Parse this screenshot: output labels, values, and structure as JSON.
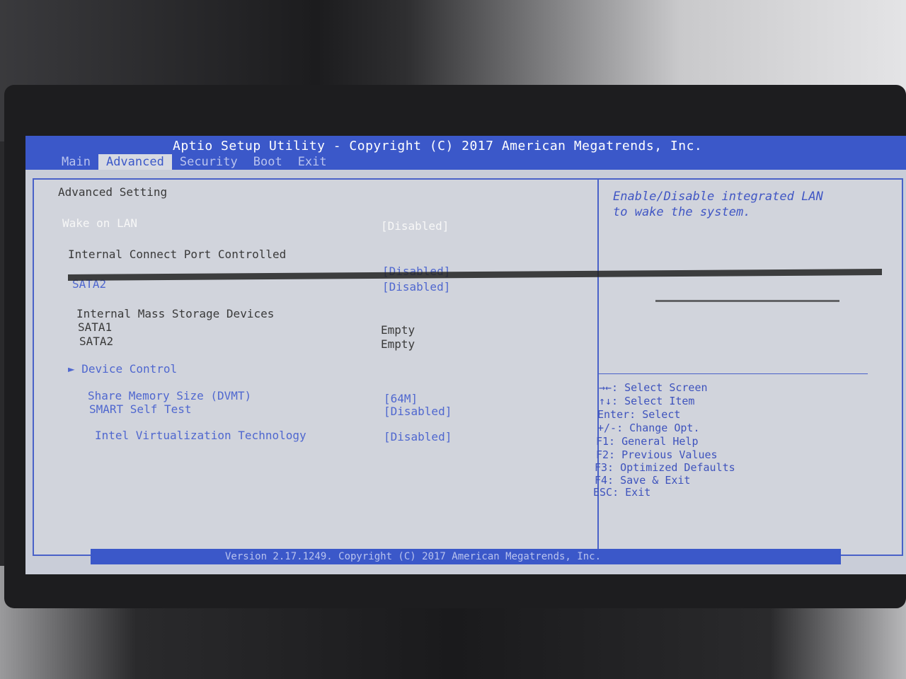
{
  "title": "Aptio Setup Utility - Copyright (C) 2017 American Megatrends, Inc.",
  "tabs": [
    {
      "label": "Main"
    },
    {
      "label": "Advanced"
    },
    {
      "label": "Security"
    },
    {
      "label": "Boot"
    },
    {
      "label": "Exit"
    }
  ],
  "main": {
    "heading": "Advanced Setting",
    "wake_on_lan": {
      "label": "Wake on LAN",
      "value": "[Disabled]"
    },
    "internal_connect_heading": "Internal Connect Port Controlled",
    "port_sata1": {
      "value": "[Disabled]"
    },
    "port_sata2": {
      "label": "SATA2",
      "value": "[Disabled]"
    },
    "mass_storage_heading": "Internal Mass Storage Devices",
    "storage_sata1": {
      "label": "SATA1",
      "value": "Empty"
    },
    "storage_sata2": {
      "label": "SATA2",
      "value": "Empty"
    },
    "device_control": {
      "arrow": "►",
      "label": "Device Control"
    },
    "share_memory": {
      "label": "Share Memory Size (DVMT)",
      "value": "[64M]"
    },
    "smart_self_test": {
      "label": "SMART Self Test",
      "value": "[Disabled]"
    },
    "virtualization": {
      "label": "Intel Virtualization Technology",
      "value": "[Disabled]"
    }
  },
  "help": {
    "line1": "Enable/Disable integrated LAN",
    "line2": "to wake the system."
  },
  "keys": [
    "→←: Select Screen",
    "↑↓: Select Item",
    "Enter: Select",
    "+/-: Change Opt.",
    "F1: General Help",
    "F2: Previous Values",
    "F3: Optimized Defaults",
    "F4: Save & Exit",
    "ESC: Exit"
  ],
  "footer": "Version 2.17.1249. Copyright (C) 2017 American Megatrends, Inc.",
  "colors": {
    "bar_blue": "#3b58c9",
    "screen_bg": "#d1d4dc",
    "accent_text": "#4f67cf"
  }
}
